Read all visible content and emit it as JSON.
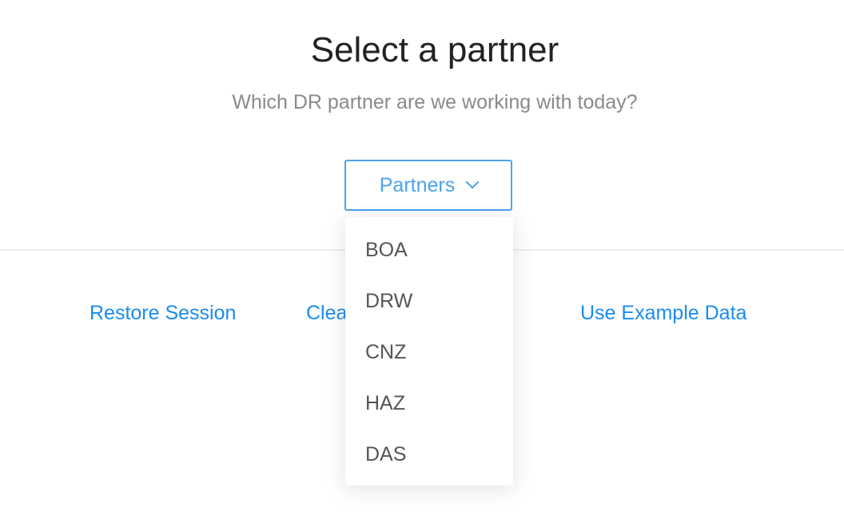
{
  "header": {
    "title": "Select a partner",
    "subtitle": "Which DR partner are we working with today?"
  },
  "partner_select": {
    "label": "Partners",
    "icon": "chevron-down-icon",
    "options": [
      "BOA",
      "DRW",
      "CNZ",
      "HAZ",
      "DAS"
    ]
  },
  "actions": {
    "restore": "Restore Session",
    "clear": "Clear Saved Session",
    "example": "Use Example Data"
  },
  "colors": {
    "accent": "#1a8cf0",
    "select_border": "#4aa3f0"
  }
}
